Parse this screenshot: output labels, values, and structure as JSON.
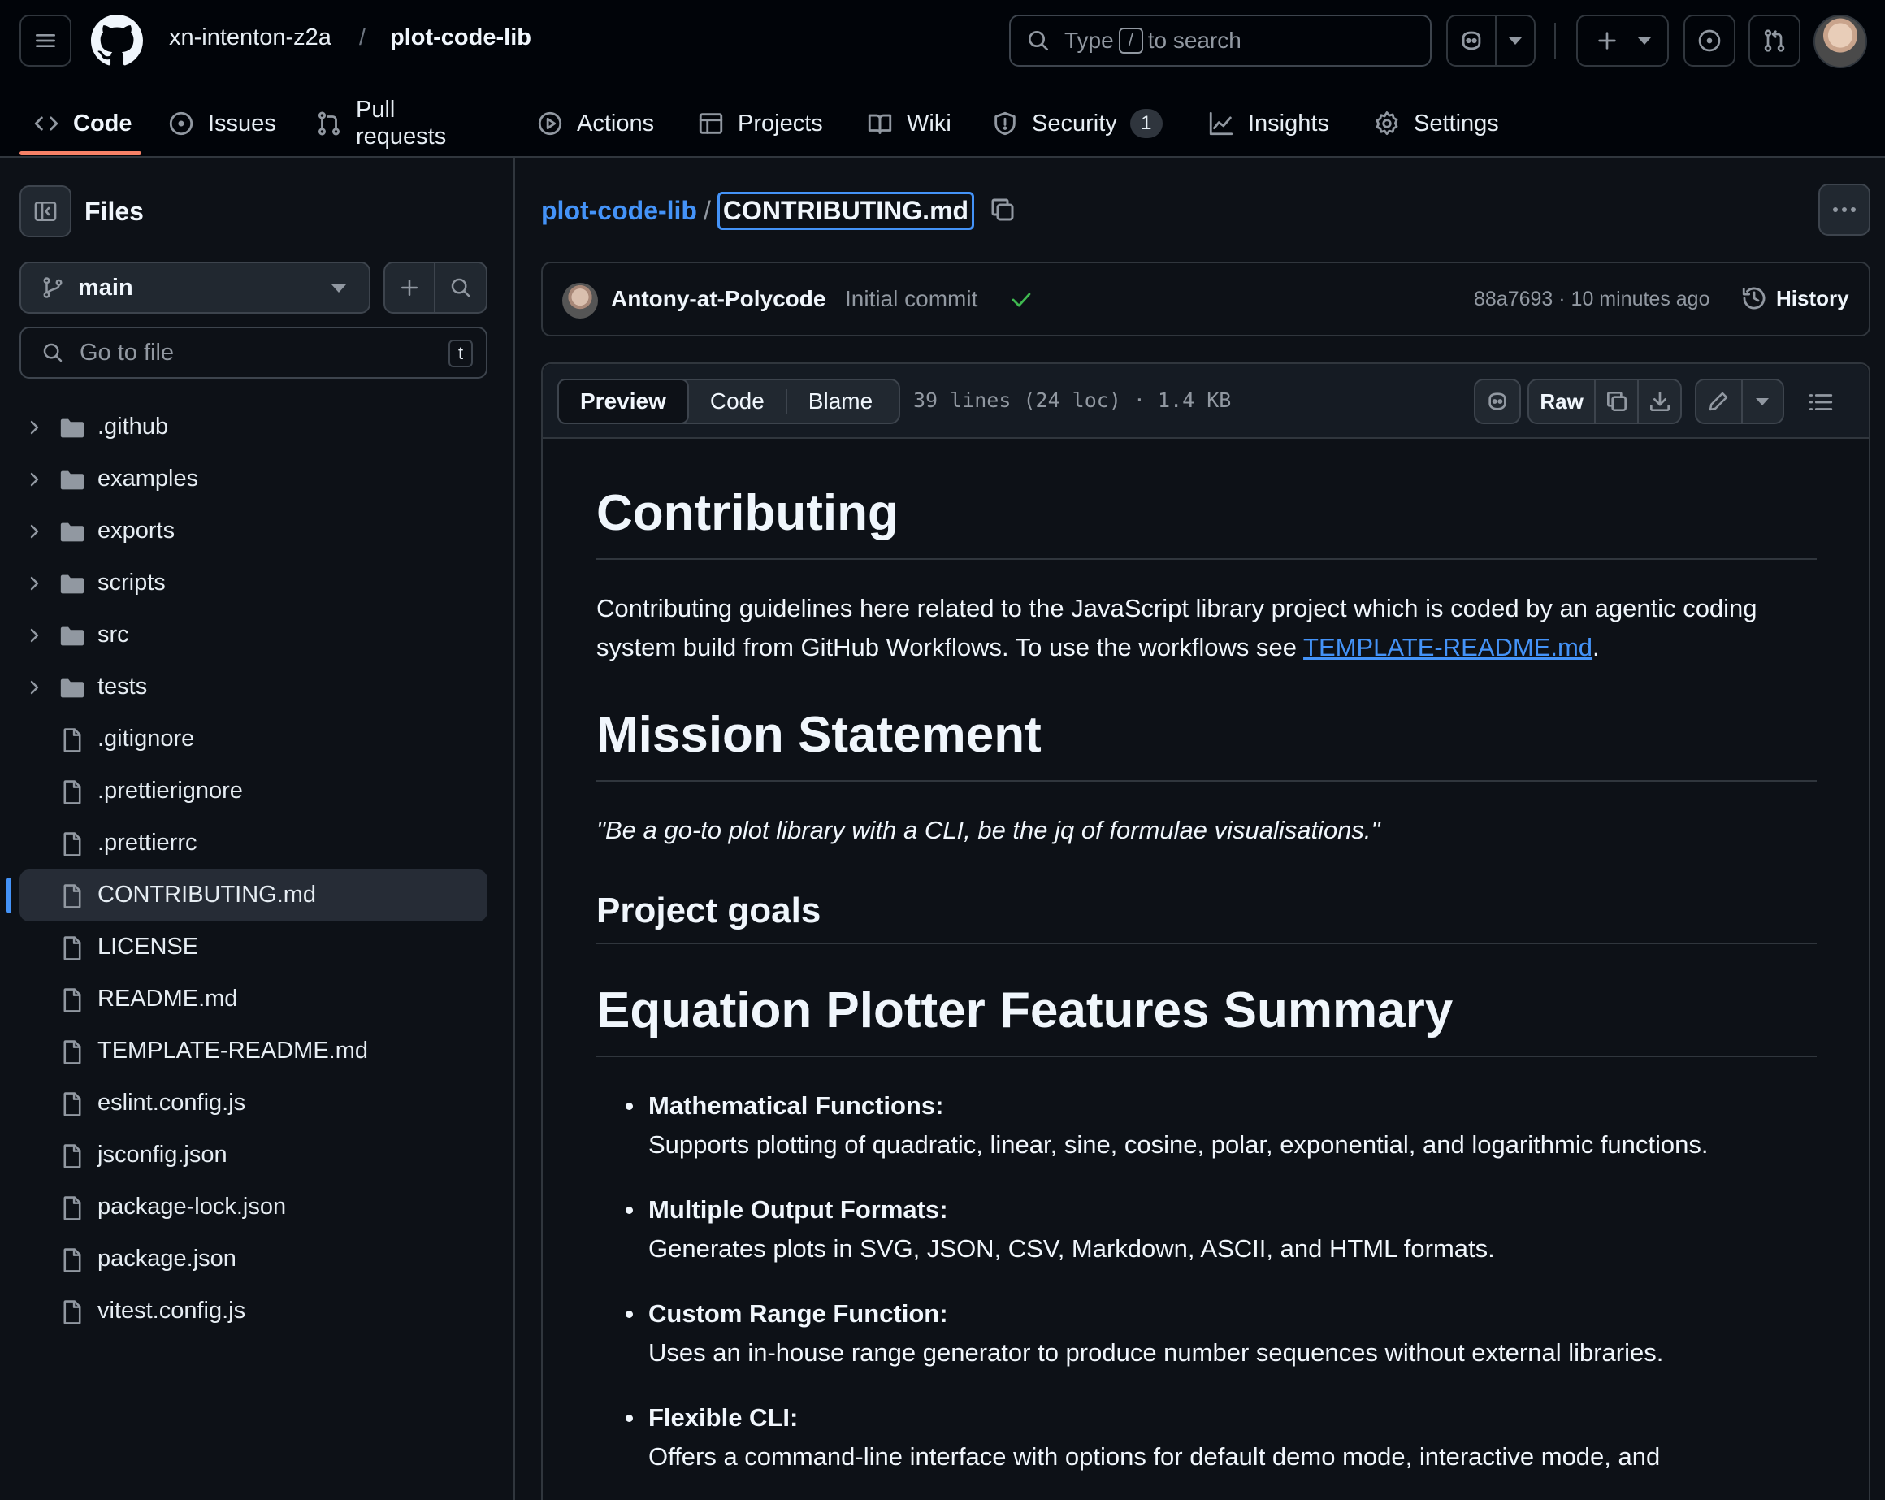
{
  "header": {
    "owner": "xn-intenton-z2a",
    "separator": "/",
    "repo": "plot-code-lib",
    "search": {
      "prefix": "Type",
      "key": "/",
      "suffix": "to search"
    }
  },
  "nav": {
    "items": [
      {
        "label": "Code",
        "icon": "code-icon",
        "active": true
      },
      {
        "label": "Issues",
        "icon": "issue-icon"
      },
      {
        "label": "Pull requests",
        "icon": "pull-request-icon"
      },
      {
        "label": "Actions",
        "icon": "play-icon"
      },
      {
        "label": "Projects",
        "icon": "table-icon"
      },
      {
        "label": "Wiki",
        "icon": "book-icon"
      },
      {
        "label": "Security",
        "icon": "shield-icon",
        "counter": "1"
      },
      {
        "label": "Insights",
        "icon": "graph-icon"
      },
      {
        "label": "Settings",
        "icon": "gear-icon"
      }
    ]
  },
  "sidebar": {
    "title": "Files",
    "branch": "main",
    "goto_placeholder": "Go to file",
    "goto_kbd": "t",
    "tree": [
      {
        "name": ".github",
        "type": "folder"
      },
      {
        "name": "examples",
        "type": "folder"
      },
      {
        "name": "exports",
        "type": "folder"
      },
      {
        "name": "scripts",
        "type": "folder"
      },
      {
        "name": "src",
        "type": "folder"
      },
      {
        "name": "tests",
        "type": "folder"
      },
      {
        "name": ".gitignore",
        "type": "file"
      },
      {
        "name": ".prettierignore",
        "type": "file"
      },
      {
        "name": ".prettierrc",
        "type": "file"
      },
      {
        "name": "CONTRIBUTING.md",
        "type": "file",
        "selected": true
      },
      {
        "name": "LICENSE",
        "type": "file"
      },
      {
        "name": "README.md",
        "type": "file"
      },
      {
        "name": "TEMPLATE-README.md",
        "type": "file"
      },
      {
        "name": "eslint.config.js",
        "type": "file"
      },
      {
        "name": "jsconfig.json",
        "type": "file"
      },
      {
        "name": "package-lock.json",
        "type": "file"
      },
      {
        "name": "package.json",
        "type": "file"
      },
      {
        "name": "vitest.config.js",
        "type": "file"
      }
    ]
  },
  "breadcrumb": {
    "repo": "plot-code-lib",
    "separator": "/",
    "file": "CONTRIBUTING.md"
  },
  "commit": {
    "author": "Antony-at-Polycode",
    "message": "Initial commit",
    "meta": "88a7693 · 10 minutes ago",
    "history_label": "History"
  },
  "file_toolbar": {
    "tabs": [
      "Preview",
      "Code",
      "Blame"
    ],
    "active_tab": "Preview",
    "meta": "39 lines (24 loc) · 1.4 KB",
    "raw_label": "Raw"
  },
  "markdown": {
    "h1_contributing": "Contributing",
    "intro_text": "Contributing guidelines here related to the JavaScript library project which is coded by an agentic coding system build from GitHub Workflows. To use the workflows see ",
    "intro_link": "TEMPLATE-README.md",
    "intro_end": ".",
    "h1_mission": "Mission Statement",
    "mission_quote": "\"Be a go-to plot library with a CLI, be the jq of formulae visualisations.\"",
    "h2_goals": "Project goals",
    "h1_features": "Equation Plotter Features Summary",
    "features": [
      {
        "title": "Mathematical Functions:",
        "text": "Supports plotting of quadratic, linear, sine, cosine, polar, exponential, and logarithmic functions."
      },
      {
        "title": "Multiple Output Formats:",
        "text": "Generates plots in SVG, JSON, CSV, Markdown, ASCII, and HTML formats."
      },
      {
        "title": "Custom Range Function:",
        "text": "Uses an in-house range generator to produce number sequences without external libraries."
      },
      {
        "title": "Flexible CLI:",
        "text": "Offers a command-line interface with options for default demo mode, interactive mode, and"
      }
    ]
  },
  "colors": {
    "accent_link": "#4493f8",
    "nav_underline": "#f78166",
    "success_check": "#3fb950",
    "background": "#0d1117"
  }
}
